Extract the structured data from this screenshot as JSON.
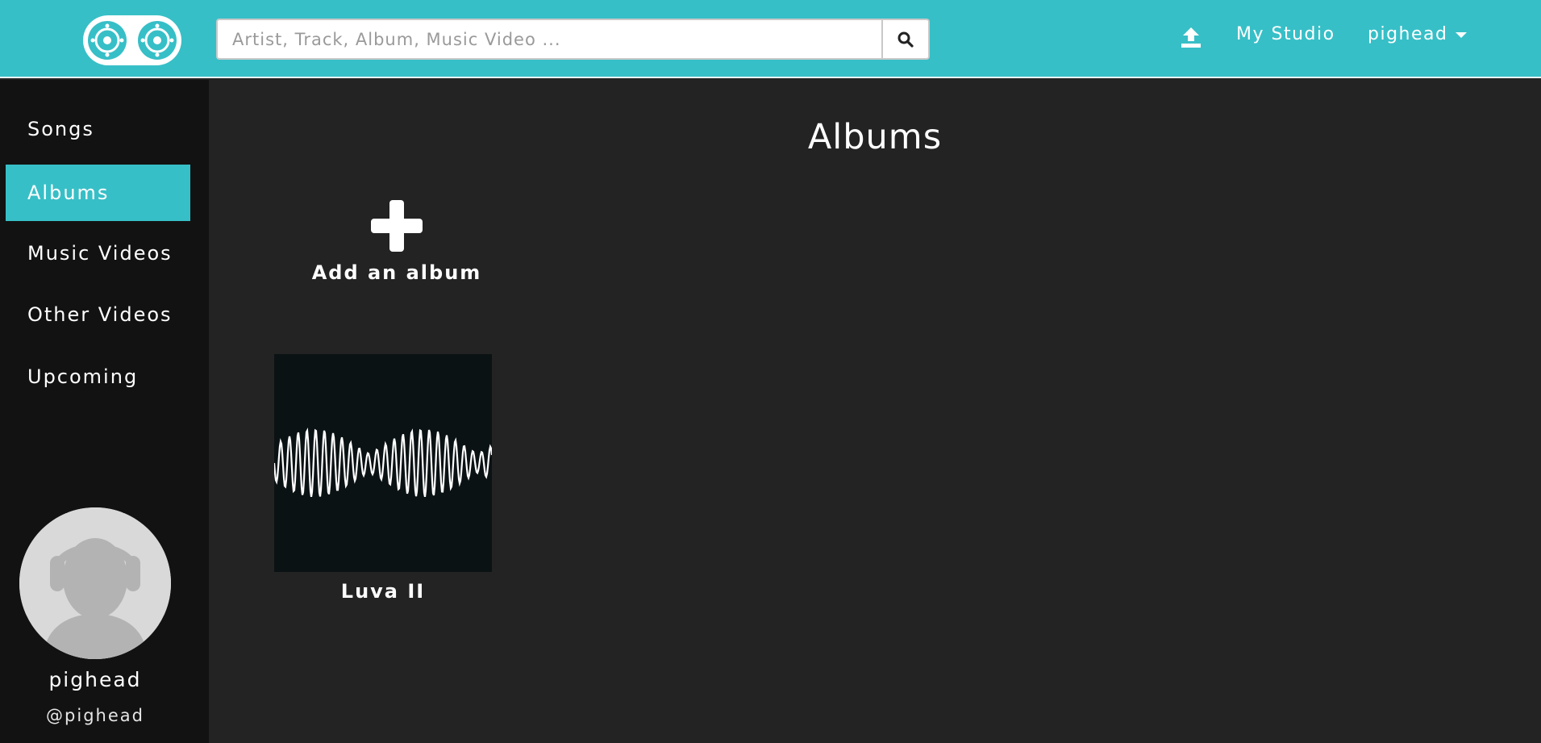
{
  "header": {
    "search_placeholder": "Artist, Track, Album, Music Video ...",
    "my_studio_label": "My Studio",
    "user_menu_label": "pighead"
  },
  "sidebar": {
    "items": [
      {
        "label": "Songs",
        "active": false
      },
      {
        "label": "Albums",
        "active": true
      },
      {
        "label": "Music Videos",
        "active": false
      },
      {
        "label": "Other Videos",
        "active": false
      },
      {
        "label": "Upcoming",
        "active": false
      }
    ],
    "profile": {
      "name": "pighead",
      "handle": "@pighead"
    }
  },
  "main": {
    "title": "Albums",
    "add_album_label": "Add an album",
    "albums": [
      {
        "title": "Luva II"
      }
    ]
  },
  "icons": {
    "logo": "cassette-logo",
    "search": "search-icon",
    "upload": "upload-icon",
    "dropdown": "caret-down-icon",
    "add": "plus-icon",
    "avatar": "headphones-avatar"
  },
  "colors": {
    "accent": "#37bfc7",
    "sidebar_bg": "#121212",
    "main_bg": "#232323",
    "album_cover_bg": "#0b1214"
  }
}
